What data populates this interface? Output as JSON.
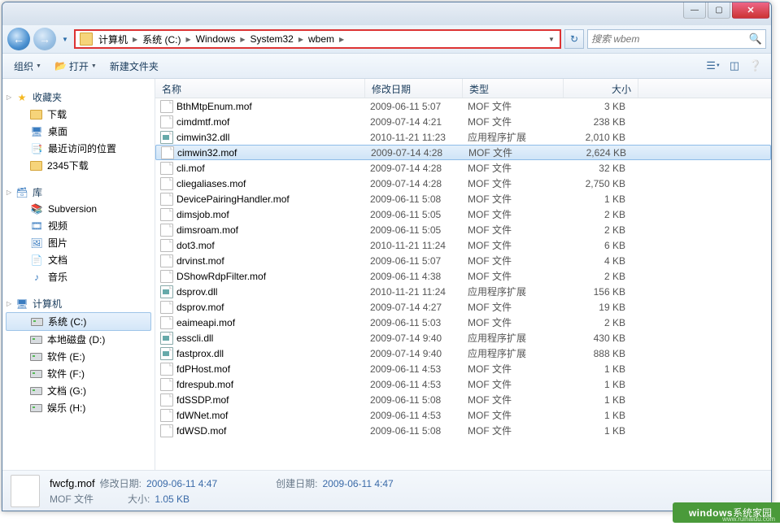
{
  "window_controls": {
    "min": "—",
    "max": "▢",
    "close": "✕"
  },
  "nav": {
    "back": "←",
    "forward": "→"
  },
  "breadcrumbs": [
    "计算机",
    "系统 (C:)",
    "Windows",
    "System32",
    "wbem"
  ],
  "search": {
    "placeholder": "搜索 wbem"
  },
  "toolbar": {
    "organize": "组织",
    "open": "打开",
    "newfolder": "新建文件夹"
  },
  "sidebar": {
    "favorites": {
      "label": "收藏夹",
      "items": [
        "下载",
        "桌面",
        "最近访问的位置",
        "2345下载"
      ]
    },
    "libraries": {
      "label": "库",
      "items": [
        "Subversion",
        "视频",
        "图片",
        "文档",
        "音乐"
      ]
    },
    "computer": {
      "label": "计算机",
      "items": [
        "系统 (C:)",
        "本地磁盘 (D:)",
        "软件 (E:)",
        "软件 (F:)",
        "文档 (G:)",
        "娱乐 (H:)"
      ]
    }
  },
  "columns": {
    "name": "名称",
    "date": "修改日期",
    "type": "类型",
    "size": "大小"
  },
  "files": [
    {
      "name": "BthMtpEnum.mof",
      "date": "2009-06-11 5:07",
      "type": "MOF 文件",
      "size": "3 KB",
      "ext": "mof"
    },
    {
      "name": "cimdmtf.mof",
      "date": "2009-07-14 4:21",
      "type": "MOF 文件",
      "size": "238 KB",
      "ext": "mof"
    },
    {
      "name": "cimwin32.dll",
      "date": "2010-11-21 11:23",
      "type": "应用程序扩展",
      "size": "2,010 KB",
      "ext": "dll"
    },
    {
      "name": "cimwin32.mof",
      "date": "2009-07-14 4:28",
      "type": "MOF 文件",
      "size": "2,624 KB",
      "ext": "mof",
      "selected": true
    },
    {
      "name": "cli.mof",
      "date": "2009-07-14 4:28",
      "type": "MOF 文件",
      "size": "32 KB",
      "ext": "mof"
    },
    {
      "name": "cliegaliases.mof",
      "date": "2009-07-14 4:28",
      "type": "MOF 文件",
      "size": "2,750 KB",
      "ext": "mof"
    },
    {
      "name": "DevicePairingHandler.mof",
      "date": "2009-06-11 5:08",
      "type": "MOF 文件",
      "size": "1 KB",
      "ext": "mof"
    },
    {
      "name": "dimsjob.mof",
      "date": "2009-06-11 5:05",
      "type": "MOF 文件",
      "size": "2 KB",
      "ext": "mof"
    },
    {
      "name": "dimsroam.mof",
      "date": "2009-06-11 5:05",
      "type": "MOF 文件",
      "size": "2 KB",
      "ext": "mof"
    },
    {
      "name": "dot3.mof",
      "date": "2010-11-21 11:24",
      "type": "MOF 文件",
      "size": "6 KB",
      "ext": "mof"
    },
    {
      "name": "drvinst.mof",
      "date": "2009-06-11 5:07",
      "type": "MOF 文件",
      "size": "4 KB",
      "ext": "mof"
    },
    {
      "name": "DShowRdpFilter.mof",
      "date": "2009-06-11 4:38",
      "type": "MOF 文件",
      "size": "2 KB",
      "ext": "mof"
    },
    {
      "name": "dsprov.dll",
      "date": "2010-11-21 11:24",
      "type": "应用程序扩展",
      "size": "156 KB",
      "ext": "dll"
    },
    {
      "name": "dsprov.mof",
      "date": "2009-07-14 4:27",
      "type": "MOF 文件",
      "size": "19 KB",
      "ext": "mof"
    },
    {
      "name": "eaimeapi.mof",
      "date": "2009-06-11 5:03",
      "type": "MOF 文件",
      "size": "2 KB",
      "ext": "mof"
    },
    {
      "name": "esscli.dll",
      "date": "2009-07-14 9:40",
      "type": "应用程序扩展",
      "size": "430 KB",
      "ext": "dll"
    },
    {
      "name": "fastprox.dll",
      "date": "2009-07-14 9:40",
      "type": "应用程序扩展",
      "size": "888 KB",
      "ext": "dll"
    },
    {
      "name": "fdPHost.mof",
      "date": "2009-06-11 4:53",
      "type": "MOF 文件",
      "size": "1 KB",
      "ext": "mof"
    },
    {
      "name": "fdrespub.mof",
      "date": "2009-06-11 4:53",
      "type": "MOF 文件",
      "size": "1 KB",
      "ext": "mof"
    },
    {
      "name": "fdSSDP.mof",
      "date": "2009-06-11 5:08",
      "type": "MOF 文件",
      "size": "1 KB",
      "ext": "mof"
    },
    {
      "name": "fdWNet.mof",
      "date": "2009-06-11 4:53",
      "type": "MOF 文件",
      "size": "1 KB",
      "ext": "mof"
    },
    {
      "name": "fdWSD.mof",
      "date": "2009-06-11 5:08",
      "type": "MOF 文件",
      "size": "1 KB",
      "ext": "mof"
    }
  ],
  "details": {
    "filename": "fwcfg.mof",
    "type_value": "MOF 文件",
    "mod_label": "修改日期:",
    "mod_value": "2009-06-11 4:47",
    "size_label": "大小:",
    "size_value": "1.05 KB",
    "created_label": "创建日期:",
    "created_value": "2009-06-11 4:47"
  },
  "watermark": {
    "brand": "windows",
    "text": "系统家园",
    "url": "www.ruihaidu.com"
  }
}
